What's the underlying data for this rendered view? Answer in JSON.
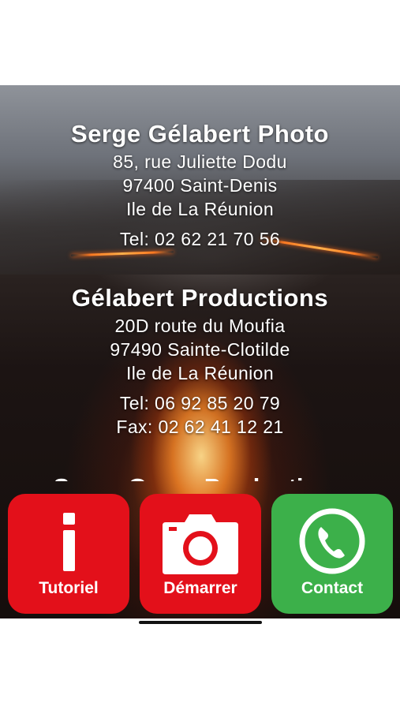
{
  "company1": {
    "name": "Serge Gélabert Photo",
    "address1": "85, rue Juliette Dodu",
    "address2": "97400 Saint-Denis",
    "region": "Ile de La Réunion",
    "phone": "Tel: 02 62 21 70 56"
  },
  "company2": {
    "name": "Gélabert Productions",
    "address1": "20D route du Moufia",
    "address2": "97490 Sainte-Clotilde",
    "region": "Ile de La Réunion",
    "phone": "Tel: 06 92 85 20 79",
    "fax": "Fax: 02 62 41 12 21"
  },
  "company3": {
    "name": "Serge Garay Productions"
  },
  "buttons": {
    "tutorial": {
      "label": "Tutoriel",
      "icon": "info-icon",
      "color": "#e3101a"
    },
    "start": {
      "label": "Démarrer",
      "icon": "camera-icon",
      "color": "#e3101a"
    },
    "contact": {
      "label": "Contact",
      "icon": "phone-icon",
      "color": "#3cb04a"
    }
  }
}
